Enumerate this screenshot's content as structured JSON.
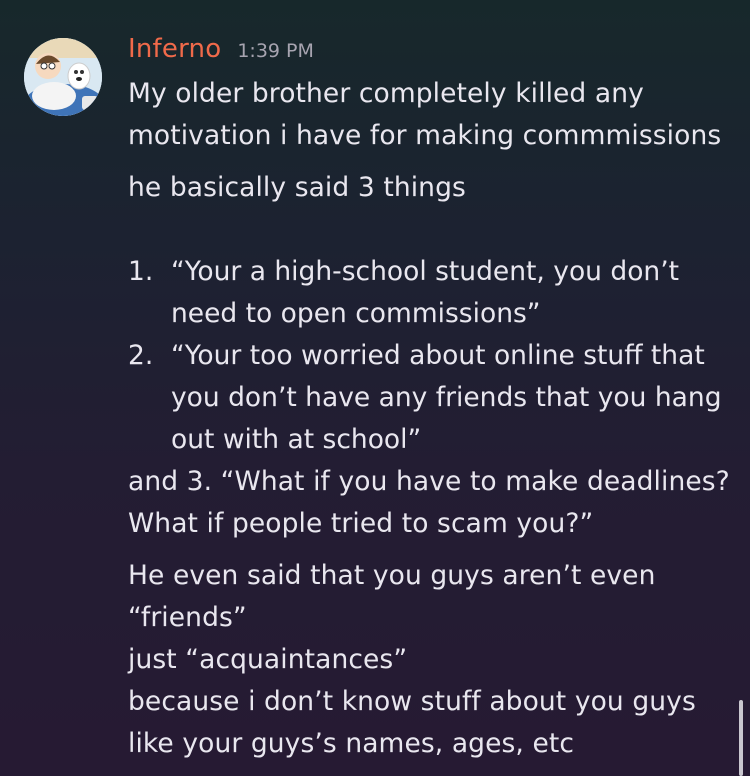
{
  "message": {
    "author": "Inferno",
    "time": "1:39 PM",
    "username_color": "#f06a4a",
    "avatar_icon": "cartoon-avatar-icon",
    "line1": "My older brother completely killed any",
    "line2": "motivation i have for making commmissions",
    "line3": "he basically said 3 things",
    "list": [
      {
        "num": "1.",
        "lines": [
          "“Your a high-school student, you don’t",
          "need to open commissions”"
        ]
      },
      {
        "num": "2.",
        "lines": [
          "“Your too worried about online stuff that",
          "you don’t have any friends that you hang",
          "out with at school”"
        ]
      }
    ],
    "after_list": [
      "and 3. “What if you have to make deadlines?",
      "What if people tried to scam you?”"
    ],
    "followup": [
      "He even said that you guys aren’t even",
      "“friends”",
      "just “acquaintances”",
      "because i don’t know stuff about you guys",
      "like your guys’s names, ages, etc"
    ]
  }
}
